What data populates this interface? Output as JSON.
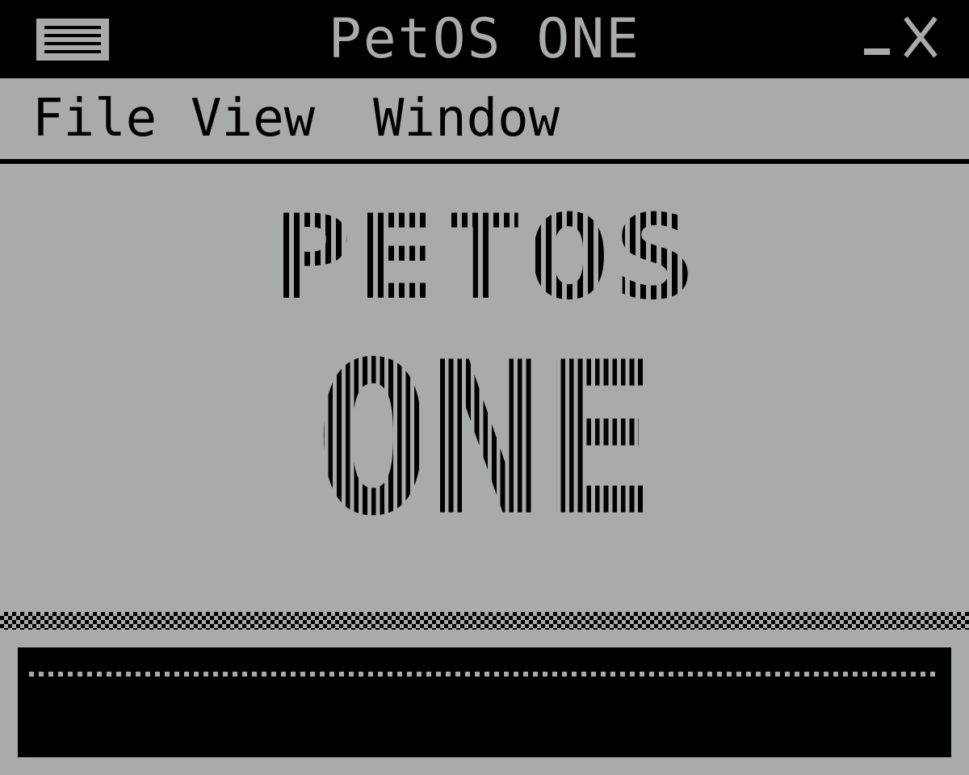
{
  "window": {
    "title": "PetOS ONE"
  },
  "menubar": {
    "items": [
      {
        "label": "File"
      },
      {
        "label": "View"
      },
      {
        "label": "Window"
      }
    ]
  },
  "logo": {
    "line1": "PETOS",
    "line2": "ONE"
  },
  "console": {
    "text": ""
  },
  "colors": {
    "background": "#a9abaa",
    "foreground": "#000000"
  }
}
